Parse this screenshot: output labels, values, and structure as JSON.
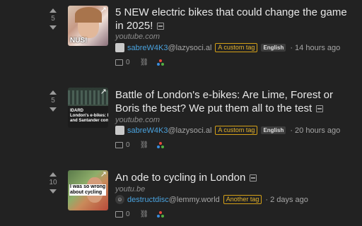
{
  "posts": [
    {
      "score": "5",
      "title": "5 NEW electric bikes that could change the game in 2025!",
      "domain": "youtube.com",
      "user": "sabreW4K3",
      "instance": "@lazysoci.al",
      "tag": "A custom tag",
      "language": "English",
      "time": "· 14 hours ago",
      "comments": "0",
      "thumb_caption": "NUS!",
      "avatar_icon": "user-avatar-square"
    },
    {
      "score": "5",
      "title": "Battle of London's e-bikes: Are Lime, Forest or Boris the best? We put them all to the test",
      "domain": "youtube.com",
      "user": "sabreW4K3",
      "instance": "@lazysoci.al",
      "tag": "A custom tag",
      "language": "English",
      "time": "· 20 hours ago",
      "comments": "0",
      "thumb_caption": "IDARD\nLondon's e-bikes: Li\nand Santander compa",
      "avatar_icon": "user-avatar-square"
    },
    {
      "score": "10",
      "title": "An ode to cycling in London",
      "domain": "youtu.be",
      "user": "destructdisc",
      "instance": "@lemmy.world",
      "tag": "Another tag",
      "time": "· 2 days ago",
      "comments": "0",
      "thumb_caption": "I was so wrong\nabout cycling",
      "avatar_icon": "user-avatar-round"
    }
  ],
  "colors": {
    "background": "#222222",
    "username": "#4aa3df",
    "tag_border": "#d4a017"
  }
}
